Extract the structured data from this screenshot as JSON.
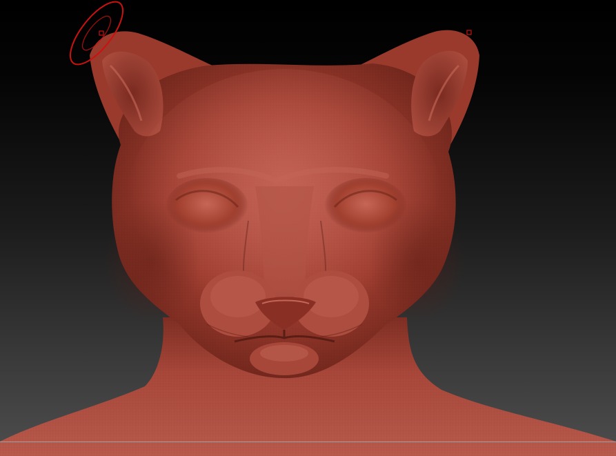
{
  "viewport": {
    "mode": "sculpt-canvas",
    "background_gradient": [
      "#000000",
      "#4d4d4d"
    ],
    "model_color": "#9c3b2e",
    "model_highlight": "#c46658",
    "model_shadow": "#5a1d15"
  },
  "brush_cursor": {
    "color": "#cc1111",
    "shape": "ellipse-ring"
  },
  "symmetry_markers": {
    "color": "#cc1111",
    "count": 2
  },
  "floor_line": {
    "color": "#a0a0a0"
  },
  "subject": {
    "icon": "sculpted-feline-bust"
  }
}
